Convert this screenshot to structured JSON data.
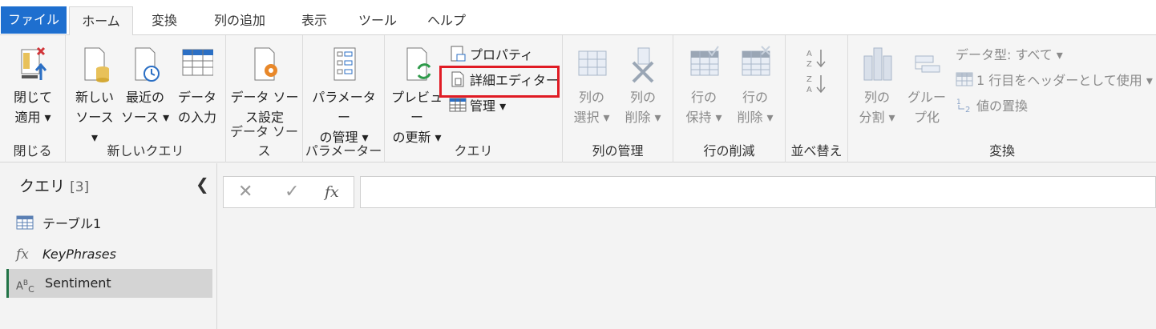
{
  "tabs": [
    "ファイル",
    "ホーム",
    "変換",
    "列の追加",
    "表示",
    "ツール",
    "ヘルプ"
  ],
  "groups": {
    "close": {
      "label": "閉じる",
      "btn_line1": "閉じて",
      "btn_line2": "適用 ▾"
    },
    "new_query": {
      "label": "新しいクエリ",
      "new_source_1": "新しい",
      "new_source_2": "ソース ▾",
      "recent_1": "最近の",
      "recent_2": "ソース ▾",
      "enter_1": "データ",
      "enter_2": "の入力"
    },
    "data_source": {
      "label": "データ ソース",
      "btn_line1": "データ ソー",
      "btn_line2": "ス設定"
    },
    "params": {
      "label": "パラメーター",
      "btn_line1": "パラメーター",
      "btn_line2": "の管理 ▾"
    },
    "query": {
      "label": "クエリ",
      "refresh_1": "プレビュー",
      "refresh_2": "の更新 ▾",
      "properties": "プロパティ",
      "advanced_editor": "詳細エディター",
      "manage": "管理 ▾"
    },
    "manage_cols": {
      "label": "列の管理",
      "choose_1": "列の",
      "choose_2": "選択 ▾",
      "remove_1": "列の",
      "remove_2": "削除 ▾"
    },
    "reduce_rows": {
      "label": "行の削減",
      "keep_1": "行の",
      "keep_2": "保持 ▾",
      "remove_1": "行の",
      "remove_2": "削除 ▾"
    },
    "sort": {
      "label": "並べ替え"
    },
    "transform": {
      "label": "変換",
      "split_1": "列の",
      "split_2": "分割 ▾",
      "group_1": "グルー",
      "group_2": "プ化",
      "data_type": "データ型: すべて ▾",
      "first_row_header": "1 行目をヘッダーとして使用 ▾",
      "replace_values": "値の置換"
    }
  },
  "query_pane": {
    "title": "クエリ",
    "count": "[3]",
    "items": [
      {
        "icon": "table-icon",
        "name": "テーブル1"
      },
      {
        "icon": "fx-icon",
        "name": "KeyPhrases"
      },
      {
        "icon": "abc-icon",
        "name": "Sentiment"
      }
    ]
  },
  "formula_bar": {
    "cancel": "✕",
    "commit": "✓",
    "fx": "fx",
    "value": ""
  },
  "colors": {
    "file_tab": "#1e6fcf",
    "highlight": "#e01b24",
    "selected_accent": "#217346"
  }
}
